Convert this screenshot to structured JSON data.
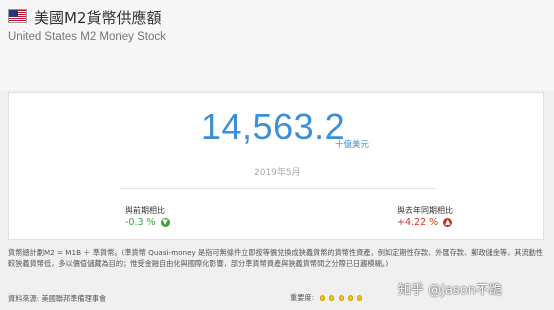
{
  "header": {
    "title": "美國M2貨幣供應額",
    "subtitle": "United States M2 Money Stock",
    "flag_icon": "us-flag-icon"
  },
  "indicator": {
    "value": "14,563.2",
    "unit": "十億美元",
    "date": "2019年5月"
  },
  "stats": {
    "prev_label": "與前期相比",
    "prev_value": "-0.3 %",
    "prev_direction": "down",
    "prev_color": "#3aa635",
    "yoy_label": "與去年同期相比",
    "yoy_value": "+4.22 %",
    "yoy_direction": "up",
    "yoy_color": "#d0352d"
  },
  "note": {
    "text": "貨幣總計劃M2 = M1B ＋ 準貨幣。(準貨幣 Quasi-money 是指可無條件立即按等價兌換成狹義貨幣的貨幣性資產，例如定期性存款、外匯存款、郵政儲金等，其流動性較狹義貨幣低，多以價值儲藏為目的；惟受金融自由化與國際化影響，部分準貨幣資產與狹義貨幣間之分際已日趨模糊。)"
  },
  "footer": {
    "source": "資料來源: 美國聯邦準備理事會",
    "importance_label": "重要度:",
    "importance_level": 5,
    "watermark": "知乎 @Jason不跪"
  },
  "colors": {
    "accent": "#3d8fd6",
    "positive": "#3aa635",
    "negative": "#d0352d"
  }
}
